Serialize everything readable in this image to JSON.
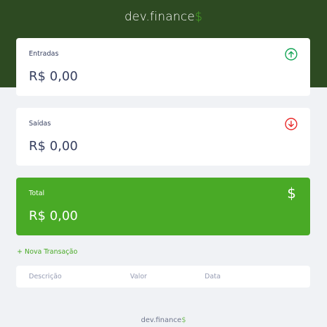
{
  "header": {
    "logo_text": "dev.finance",
    "logo_accent": "$"
  },
  "cards": {
    "income": {
      "label": "Entradas",
      "value": "R$ 0,00",
      "icon": "arrow-up-circle-icon",
      "icon_color": "#12a454"
    },
    "expense": {
      "label": "Saídas",
      "value": "R$ 0,00",
      "icon": "arrow-down-circle-icon",
      "icon_color": "#e92929"
    },
    "total": {
      "label": "Total",
      "value": "R$ 0,00",
      "icon": "dollar-icon",
      "background": "#49aa26"
    }
  },
  "actions": {
    "new_transaction": "+ Nova Transação"
  },
  "table": {
    "columns": [
      "Descrição",
      "Valor",
      "Data"
    ]
  },
  "footer": {
    "text": "dev.finance",
    "accent": "$"
  },
  "colors": {
    "header_bg": "#2d4a22",
    "accent": "#49aa26",
    "page_bg": "#f0f2f5"
  }
}
